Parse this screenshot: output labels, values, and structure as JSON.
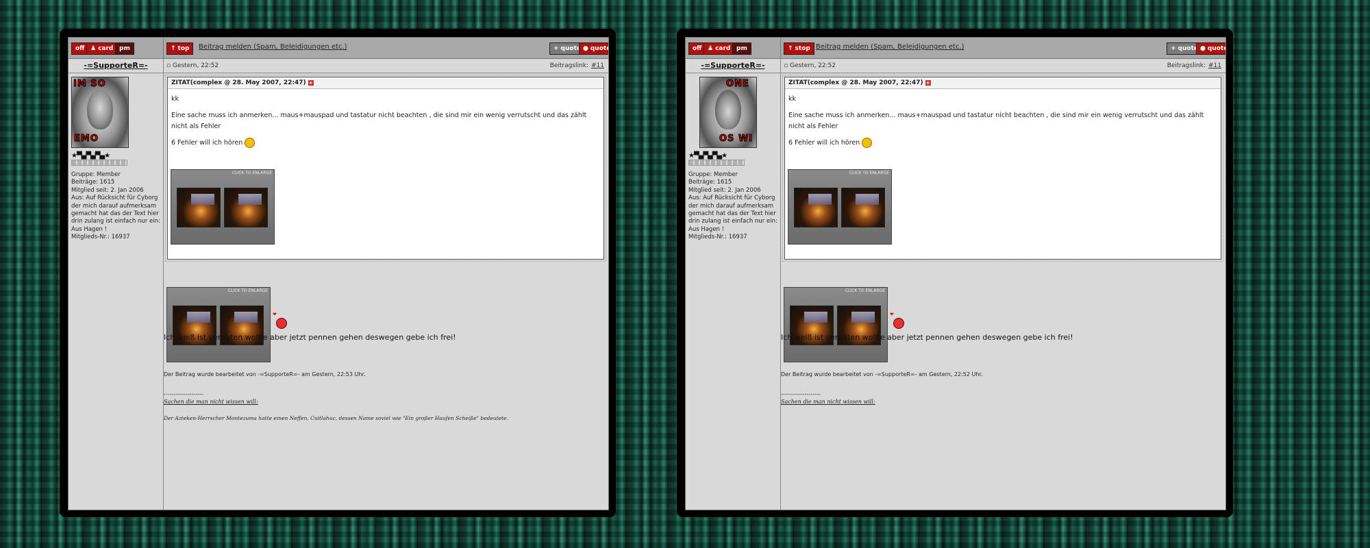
{
  "toolbar": {
    "off": "off",
    "card": "card",
    "pm": "pm",
    "top": "top",
    "stop": "stop",
    "report": "Beitrag melden (Spam, Beleidigungen etc.)",
    "quote_add": "quote",
    "quote": "quote"
  },
  "user": {
    "name": "-=SupporteR=-",
    "stars": "★▀▄▀▄▀▄★",
    "group": "Gruppe: Member",
    "posts": "Beiträge: 1615",
    "joined": "Mitglied seit: 2. Jan 2006",
    "from": "Aus: Auf Rücksicht für Cyborg der mich darauf aufmerksam gemacht hat das der Text hier drin zulang ist einfach nur ein: Aus Hagen !",
    "member_no": "Mitglieds-Nr.: 16937"
  },
  "avatar_left": {
    "top_text": "IM SO",
    "bottom_text": "EMO"
  },
  "avatar_right": {
    "top_text": "ONE",
    "bottom_text": "OS WI"
  },
  "post": {
    "date": "Gestern, 22:52",
    "link_label": "Beitragslink:",
    "link_no": "#11",
    "quote_header": "ZITAT(complex @ 28. May 2007, 22:47)",
    "quote_line1": "kk",
    "quote_line2": "Eine sache muss ich anmerken... maus+mauspad und tastatur nicht beachten , die sind mir ein wenig verrutscht und das zählt nicht als Fehler",
    "quote_line3": "6 Fehler will ich hören",
    "thumb_caption": "CLICK TO ENLARGE",
    "message": "Ich weiß ist verboten wollte aber jetzt pennen gehen deswegen gebe ich frei!",
    "edited_left": "Der Beitrag wurde bearbeitet von -=SupporteR=- am Gestern, 22:53 Uhr.",
    "edited_right": "Der Beitrag wurde bearbeitet von -=SupporteR=- am Gestern, 22:52 Uhr.",
    "sig_sep": "--------------------",
    "sig_link": "Sachen die man nicht wissen will:",
    "sig_text": "Der Azteken-Herrscher Montezuma hatte einen Neffen, Cuitlahuc, dessen Name soviel wie \"Ein großer Haufen Scheiße\" bedeutete."
  }
}
